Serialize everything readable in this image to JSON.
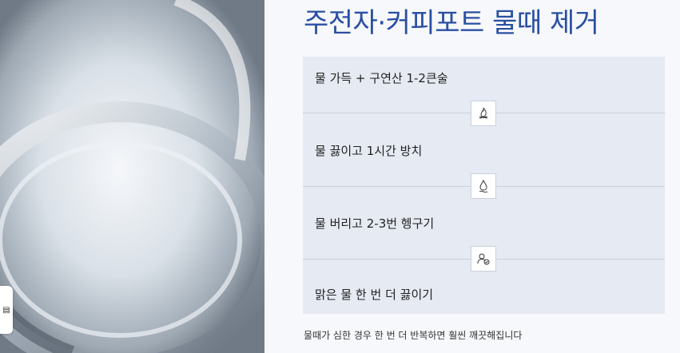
{
  "title": "주전자·커피포트 물때 제거",
  "steps": [
    {
      "label": "물 가득 + 구연산 1-2큰술"
    },
    {
      "label": "물 끓이고 1시간 방치"
    },
    {
      "label": "물 버리고 2-3번 헹구기"
    },
    {
      "label": "맑은 물 한 번 더 끓이기"
    }
  ],
  "connector_icons": [
    "fire-icon",
    "water-drop-icon",
    "rinse-hands-icon"
  ],
  "note": "물때가 심한 경우 한 번 더 반복하면 훨씬 깨끗해집니다",
  "colors": {
    "title": "#2a4fa3",
    "panel": "#e6eaf2",
    "divider": "#c9d1dd"
  }
}
